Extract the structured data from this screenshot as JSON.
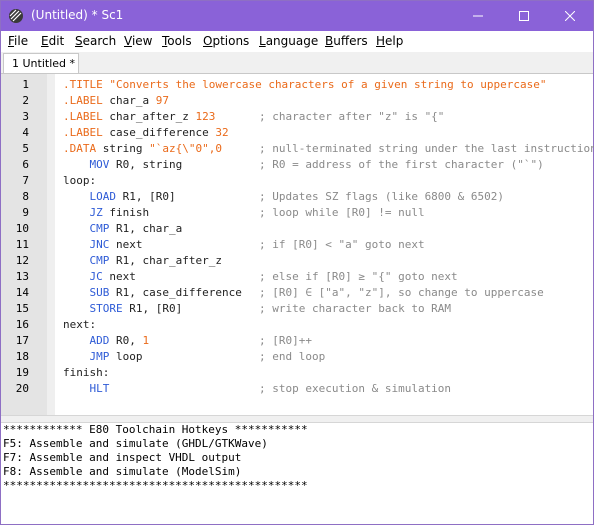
{
  "window": {
    "title": "(Untitled) * Sc1",
    "icon": "sc1-app-icon",
    "controls": {
      "minimize": "minimize-icon",
      "maximize": "maximize-icon",
      "close": "close-icon"
    }
  },
  "menu": [
    {
      "mnemonic": "F",
      "rest": "ile"
    },
    {
      "mnemonic": "E",
      "rest": "dit"
    },
    {
      "mnemonic": "S",
      "rest": "earch"
    },
    {
      "mnemonic": "V",
      "rest": "iew"
    },
    {
      "mnemonic": "T",
      "rest": "ools"
    },
    {
      "mnemonic": "O",
      "rest": "ptions"
    },
    {
      "mnemonic": "L",
      "rest": "anguage"
    },
    {
      "mnemonic": "B",
      "rest": "uffers"
    },
    {
      "mnemonic": "H",
      "rest": "elp"
    }
  ],
  "tabs": [
    {
      "label": "1 Untitled *"
    }
  ],
  "editor": {
    "lines": [
      {
        "num": "1",
        "parts": [
          [
            "kw",
            ".TITLE"
          ],
          [
            "",
            " "
          ],
          [
            "str",
            "\"Converts the lowercase characters of a given string to uppercase\""
          ]
        ],
        "comment": ""
      },
      {
        "num": "2",
        "parts": [
          [
            "kw",
            ".LABEL"
          ],
          [
            "",
            " char_a "
          ],
          [
            "num",
            "97"
          ]
        ],
        "comment": ""
      },
      {
        "num": "3",
        "parts": [
          [
            "kw",
            ".LABEL"
          ],
          [
            "",
            " char_after_z "
          ],
          [
            "num",
            "123"
          ]
        ],
        "comment": "; character after \"z\" is \"{\""
      },
      {
        "num": "4",
        "parts": [
          [
            "kw",
            ".LABEL"
          ],
          [
            "",
            " case_difference "
          ],
          [
            "num",
            "32"
          ]
        ],
        "comment": ""
      },
      {
        "num": "5",
        "parts": [
          [
            "kw",
            ".DATA"
          ],
          [
            "",
            " string "
          ],
          [
            "str",
            "\"`az{\\\"0\",0"
          ]
        ],
        "comment": "; null-terminated string under the last instruction"
      },
      {
        "num": "6",
        "parts": [
          [
            "",
            "    "
          ],
          [
            "ins",
            "MOV"
          ],
          [
            "",
            " R0, string"
          ]
        ],
        "comment": "; R0 = address of the first character (\"`\")"
      },
      {
        "num": "7",
        "parts": [
          [
            "",
            "loop:"
          ]
        ],
        "comment": ""
      },
      {
        "num": "8",
        "parts": [
          [
            "",
            "    "
          ],
          [
            "ins",
            "LOAD"
          ],
          [
            "",
            " R1, [R0]"
          ]
        ],
        "comment": "; Updates SZ flags (like 6800 & 6502)"
      },
      {
        "num": "9",
        "parts": [
          [
            "",
            "    "
          ],
          [
            "ins",
            "JZ"
          ],
          [
            "",
            " finish"
          ]
        ],
        "comment": "; loop while [R0] != null"
      },
      {
        "num": "10",
        "parts": [
          [
            "",
            "    "
          ],
          [
            "ins",
            "CMP"
          ],
          [
            "",
            " R1, char_a"
          ]
        ],
        "comment": ""
      },
      {
        "num": "11",
        "parts": [
          [
            "",
            "    "
          ],
          [
            "ins",
            "JNC"
          ],
          [
            "",
            " next"
          ]
        ],
        "comment": "; if [R0] < \"a\" goto next"
      },
      {
        "num": "12",
        "parts": [
          [
            "",
            "    "
          ],
          [
            "ins",
            "CMP"
          ],
          [
            "",
            " R1, char_after_z"
          ]
        ],
        "comment": ""
      },
      {
        "num": "13",
        "parts": [
          [
            "",
            "    "
          ],
          [
            "ins",
            "JC"
          ],
          [
            "",
            " next"
          ]
        ],
        "comment": "; else if [R0] ≥ \"{\" goto next"
      },
      {
        "num": "14",
        "parts": [
          [
            "",
            "    "
          ],
          [
            "ins",
            "SUB"
          ],
          [
            "",
            " R1, case_difference"
          ]
        ],
        "comment": "; [R0] ∈ [\"a\", \"z\"], so change to uppercase"
      },
      {
        "num": "15",
        "parts": [
          [
            "",
            "    "
          ],
          [
            "ins",
            "STORE"
          ],
          [
            "",
            " R1, [R0]"
          ]
        ],
        "comment": "; write character back to RAM"
      },
      {
        "num": "16",
        "parts": [
          [
            "",
            "next:"
          ]
        ],
        "comment": ""
      },
      {
        "num": "17",
        "parts": [
          [
            "",
            "    "
          ],
          [
            "ins",
            "ADD"
          ],
          [
            "",
            " R0, "
          ],
          [
            "num",
            "1"
          ]
        ],
        "comment": "; [R0]++"
      },
      {
        "num": "18",
        "parts": [
          [
            "",
            "    "
          ],
          [
            "ins",
            "JMP"
          ],
          [
            "",
            " loop"
          ]
        ],
        "comment": "; end loop"
      },
      {
        "num": "19",
        "parts": [
          [
            "",
            "finish:"
          ]
        ],
        "comment": ""
      },
      {
        "num": "20",
        "parts": [
          [
            "",
            "    "
          ],
          [
            "ins",
            "HLT"
          ]
        ],
        "comment": "; stop execution & simulation"
      }
    ]
  },
  "output": {
    "lines": [
      "************ E80 Toolchain Hotkeys ***********",
      "F5: Assemble and simulate (GHDL/GTKWave)",
      "F7: Assemble and inspect VHDL output",
      "F8: Assemble and simulate (ModelSim)",
      "**********************************************"
    ]
  },
  "colors": {
    "titlebar": "#8a62d8",
    "directive": "#ea6a1a",
    "instruction": "#2e5bd6",
    "comment": "#8a8a8a"
  }
}
